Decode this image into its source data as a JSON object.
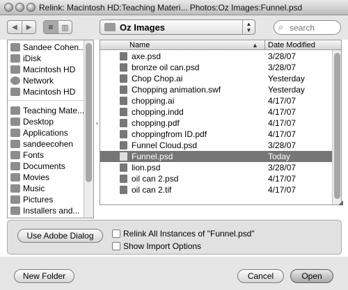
{
  "window": {
    "title": "Relink: Macintosh HD:Teaching Materi... Photos:Oz Images:Funnel.psd"
  },
  "toolbar": {
    "back_icon": "back-arrow-icon",
    "forward_icon": "forward-arrow-icon",
    "list_view_icon": "list-view-icon",
    "column_view_icon": "column-view-icon",
    "location": "Oz Images",
    "search_placeholder": "search"
  },
  "sidebar": {
    "devices": [
      {
        "label": "Sandee Cohen..."
      },
      {
        "label": "iDisk"
      },
      {
        "label": "Macintosh HD"
      },
      {
        "label": "Network"
      },
      {
        "label": "Macintosh HD"
      }
    ],
    "places": [
      {
        "label": "Teaching Mate..."
      },
      {
        "label": "Desktop"
      },
      {
        "label": "Applications"
      },
      {
        "label": "sandeecohen"
      },
      {
        "label": "Fonts"
      },
      {
        "label": "Documents"
      },
      {
        "label": "Movies"
      },
      {
        "label": "Music"
      },
      {
        "label": "Pictures"
      },
      {
        "label": "Installers and..."
      }
    ]
  },
  "files": {
    "columns": {
      "name": "Name",
      "date": "Date Modified"
    },
    "rows": [
      {
        "name": "axe.psd",
        "date": "3/28/07",
        "selected": false
      },
      {
        "name": "bronze oil can.psd",
        "date": "3/28/07",
        "selected": false
      },
      {
        "name": "Chop Chop.ai",
        "date": "Yesterday",
        "selected": false
      },
      {
        "name": "Chopping animation.swf",
        "date": "Yesterday",
        "selected": false
      },
      {
        "name": "chopping.ai",
        "date": "4/17/07",
        "selected": false
      },
      {
        "name": "chopping.indd",
        "date": "4/17/07",
        "selected": false
      },
      {
        "name": "chopping.pdf",
        "date": "4/17/07",
        "selected": false
      },
      {
        "name": "choppingfrom ID.pdf",
        "date": "4/17/07",
        "selected": false
      },
      {
        "name": "Funnel Cloud.psd",
        "date": "3/28/07",
        "selected": false
      },
      {
        "name": "Funnel.psd",
        "date": "Today",
        "selected": true
      },
      {
        "name": "lion.psd",
        "date": "3/28/07",
        "selected": false
      },
      {
        "name": "oil can 2.psd",
        "date": "4/17/07",
        "selected": false
      },
      {
        "name": "oil can 2.tif",
        "date": "4/17/07",
        "selected": false
      }
    ]
  },
  "options": {
    "adobe_dialog_label": "Use Adobe Dialog",
    "relink_all_label": "Relink All Instances of \"Funnel.psd\"",
    "relink_all_checked": false,
    "show_import_label": "Show Import Options",
    "show_import_checked": false
  },
  "footer": {
    "new_folder_label": "New Folder",
    "cancel_label": "Cancel",
    "open_label": "Open"
  }
}
